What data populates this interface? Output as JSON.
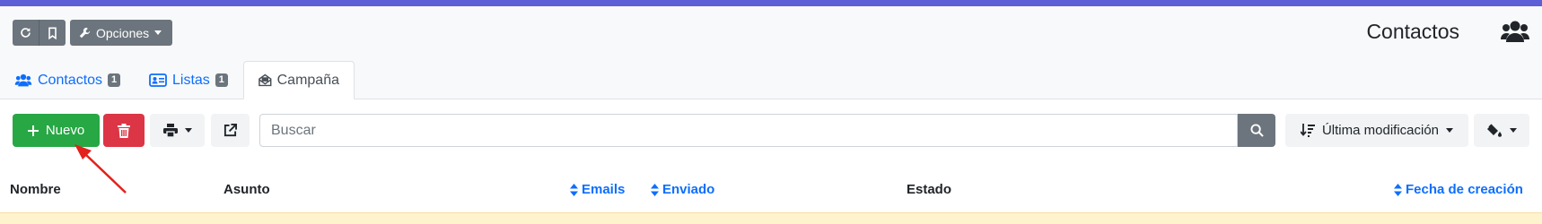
{
  "toolbar": {
    "opciones_label": "Opciones"
  },
  "header": {
    "title": "Contactos"
  },
  "tabs": [
    {
      "label": "Contactos",
      "count": "1"
    },
    {
      "label": "Listas",
      "count": "1"
    },
    {
      "label": "Campaña"
    }
  ],
  "actions": {
    "new_label": "Nuevo",
    "search_placeholder": "Buscar",
    "sort_label": "Última modificación"
  },
  "table": {
    "columns": [
      "Nombre",
      "Asunto",
      "Emails",
      "Enviado",
      "Estado",
      "Fecha de creación"
    ]
  },
  "colors": {
    "accent": "#0d6efd",
    "success": "#28a745",
    "danger": "#dc3545",
    "secondary": "#6c757d",
    "top_strip": "#5c5fd6",
    "annotation_arrow": "#e3201b"
  },
  "icons": [
    "reload-icon",
    "bookmark-icon",
    "wrench-icon",
    "users-icon",
    "address-card-icon",
    "envelope-open-icon",
    "plus-icon",
    "trash-icon",
    "print-icon",
    "external-link-icon",
    "search-icon",
    "sort-amount-down-icon",
    "fill-drip-icon",
    "sort-icon"
  ]
}
